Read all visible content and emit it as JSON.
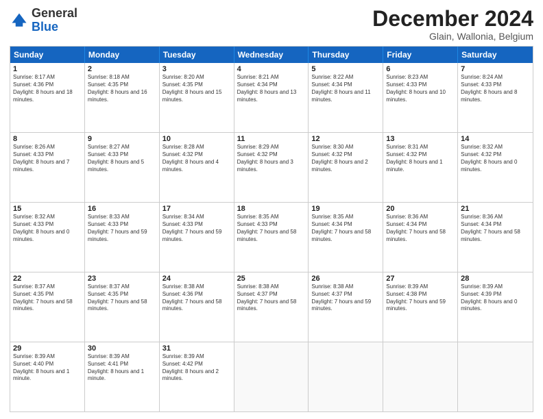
{
  "header": {
    "logo_general": "General",
    "logo_blue": "Blue",
    "month": "December 2024",
    "location": "Glain, Wallonia, Belgium"
  },
  "days": [
    "Sunday",
    "Monday",
    "Tuesday",
    "Wednesday",
    "Thursday",
    "Friday",
    "Saturday"
  ],
  "weeks": [
    [
      {
        "day": "1",
        "sunrise": "8:17 AM",
        "sunset": "4:36 PM",
        "daylight": "8 hours and 18 minutes."
      },
      {
        "day": "2",
        "sunrise": "8:18 AM",
        "sunset": "4:35 PM",
        "daylight": "8 hours and 16 minutes."
      },
      {
        "day": "3",
        "sunrise": "8:20 AM",
        "sunset": "4:35 PM",
        "daylight": "8 hours and 15 minutes."
      },
      {
        "day": "4",
        "sunrise": "8:21 AM",
        "sunset": "4:34 PM",
        "daylight": "8 hours and 13 minutes."
      },
      {
        "day": "5",
        "sunrise": "8:22 AM",
        "sunset": "4:34 PM",
        "daylight": "8 hours and 11 minutes."
      },
      {
        "day": "6",
        "sunrise": "8:23 AM",
        "sunset": "4:33 PM",
        "daylight": "8 hours and 10 minutes."
      },
      {
        "day": "7",
        "sunrise": "8:24 AM",
        "sunset": "4:33 PM",
        "daylight": "8 hours and 8 minutes."
      }
    ],
    [
      {
        "day": "8",
        "sunrise": "8:26 AM",
        "sunset": "4:33 PM",
        "daylight": "8 hours and 7 minutes."
      },
      {
        "day": "9",
        "sunrise": "8:27 AM",
        "sunset": "4:33 PM",
        "daylight": "8 hours and 5 minutes."
      },
      {
        "day": "10",
        "sunrise": "8:28 AM",
        "sunset": "4:32 PM",
        "daylight": "8 hours and 4 minutes."
      },
      {
        "day": "11",
        "sunrise": "8:29 AM",
        "sunset": "4:32 PM",
        "daylight": "8 hours and 3 minutes."
      },
      {
        "day": "12",
        "sunrise": "8:30 AM",
        "sunset": "4:32 PM",
        "daylight": "8 hours and 2 minutes."
      },
      {
        "day": "13",
        "sunrise": "8:31 AM",
        "sunset": "4:32 PM",
        "daylight": "8 hours and 1 minute."
      },
      {
        "day": "14",
        "sunrise": "8:32 AM",
        "sunset": "4:32 PM",
        "daylight": "8 hours and 0 minutes."
      }
    ],
    [
      {
        "day": "15",
        "sunrise": "8:32 AM",
        "sunset": "4:33 PM",
        "daylight": "8 hours and 0 minutes."
      },
      {
        "day": "16",
        "sunrise": "8:33 AM",
        "sunset": "4:33 PM",
        "daylight": "7 hours and 59 minutes."
      },
      {
        "day": "17",
        "sunrise": "8:34 AM",
        "sunset": "4:33 PM",
        "daylight": "7 hours and 59 minutes."
      },
      {
        "day": "18",
        "sunrise": "8:35 AM",
        "sunset": "4:33 PM",
        "daylight": "7 hours and 58 minutes."
      },
      {
        "day": "19",
        "sunrise": "8:35 AM",
        "sunset": "4:34 PM",
        "daylight": "7 hours and 58 minutes."
      },
      {
        "day": "20",
        "sunrise": "8:36 AM",
        "sunset": "4:34 PM",
        "daylight": "7 hours and 58 minutes."
      },
      {
        "day": "21",
        "sunrise": "8:36 AM",
        "sunset": "4:34 PM",
        "daylight": "7 hours and 58 minutes."
      }
    ],
    [
      {
        "day": "22",
        "sunrise": "8:37 AM",
        "sunset": "4:35 PM",
        "daylight": "7 hours and 58 minutes."
      },
      {
        "day": "23",
        "sunrise": "8:37 AM",
        "sunset": "4:35 PM",
        "daylight": "7 hours and 58 minutes."
      },
      {
        "day": "24",
        "sunrise": "8:38 AM",
        "sunset": "4:36 PM",
        "daylight": "7 hours and 58 minutes."
      },
      {
        "day": "25",
        "sunrise": "8:38 AM",
        "sunset": "4:37 PM",
        "daylight": "7 hours and 58 minutes."
      },
      {
        "day": "26",
        "sunrise": "8:38 AM",
        "sunset": "4:37 PM",
        "daylight": "7 hours and 59 minutes."
      },
      {
        "day": "27",
        "sunrise": "8:39 AM",
        "sunset": "4:38 PM",
        "daylight": "7 hours and 59 minutes."
      },
      {
        "day": "28",
        "sunrise": "8:39 AM",
        "sunset": "4:39 PM",
        "daylight": "8 hours and 0 minutes."
      }
    ],
    [
      {
        "day": "29",
        "sunrise": "8:39 AM",
        "sunset": "4:40 PM",
        "daylight": "8 hours and 1 minute."
      },
      {
        "day": "30",
        "sunrise": "8:39 AM",
        "sunset": "4:41 PM",
        "daylight": "8 hours and 1 minute."
      },
      {
        "day": "31",
        "sunrise": "8:39 AM",
        "sunset": "4:42 PM",
        "daylight": "8 hours and 2 minutes."
      },
      null,
      null,
      null,
      null
    ]
  ]
}
